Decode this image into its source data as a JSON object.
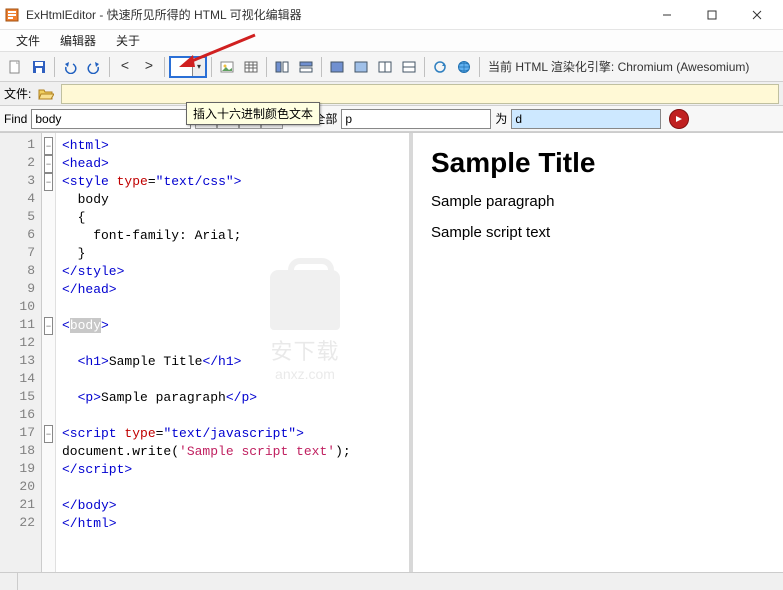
{
  "title": "ExHtmlEditor - 快速所见所得的 HTML 可视化编辑器",
  "menus": {
    "file": "文件",
    "editor": "编辑器",
    "about": "关于"
  },
  "toolbar": {
    "nav_back": "<",
    "nav_fwd": ">",
    "status_prefix": "当前 HTML 渲染化引擎:",
    "engine": "Chromium (Awesomium)"
  },
  "filebar": {
    "label": "文件:"
  },
  "findbar": {
    "find_label": "Find",
    "find_value": "body",
    "replace_all_label": "替换全部",
    "replace_value": "p",
    "to_label": "为",
    "to_value": "d"
  },
  "tooltip": "插入十六进制颜色文本",
  "code": {
    "lines": [
      {
        "n": 1,
        "fold": "-",
        "html": "<span class='t-tag'>&lt;html&gt;</span>"
      },
      {
        "n": 2,
        "fold": "-",
        "html": "<span class='t-tag'>&lt;head&gt;</span>"
      },
      {
        "n": 3,
        "fold": "-",
        "html": "<span class='t-tag'>&lt;style</span> <span class='t-attr'>type</span>=<span class='t-str'>\"text/css\"</span><span class='t-tag'>&gt;</span>"
      },
      {
        "n": 4,
        "fold": "",
        "html": "  body"
      },
      {
        "n": 5,
        "fold": "",
        "html": "  {"
      },
      {
        "n": 6,
        "fold": "",
        "html": "    font-family: Arial;"
      },
      {
        "n": 7,
        "fold": "",
        "html": "  }"
      },
      {
        "n": 8,
        "fold": "",
        "html": "<span class='t-tag'>&lt;/style&gt;</span>"
      },
      {
        "n": 9,
        "fold": "",
        "html": "<span class='t-tag'>&lt;/head&gt;</span>"
      },
      {
        "n": 10,
        "fold": "",
        "html": ""
      },
      {
        "n": 11,
        "fold": "-",
        "html": "<span class='t-tag'>&lt;</span><span class='t-sel'>body</span><span class='t-tag'>&gt;</span>"
      },
      {
        "n": 12,
        "fold": "",
        "html": ""
      },
      {
        "n": 13,
        "fold": "",
        "html": "  <span class='t-tag'>&lt;h1&gt;</span>Sample Title<span class='t-tag'>&lt;/h1&gt;</span>"
      },
      {
        "n": 14,
        "fold": "",
        "html": ""
      },
      {
        "n": 15,
        "fold": "",
        "html": "  <span class='t-tag'>&lt;p&gt;</span>Sample paragraph<span class='t-tag'>&lt;/p&gt;</span>"
      },
      {
        "n": 16,
        "fold": "",
        "html": ""
      },
      {
        "n": 17,
        "fold": "-",
        "html": "<span class='t-tag'>&lt;script</span> <span class='t-attr'>type</span>=<span class='t-str'>\"text/javascript\"</span><span class='t-tag'>&gt;</span>"
      },
      {
        "n": 18,
        "fold": "",
        "html": "document.write(<span class='t-jsstr'>'Sample script text'</span>);"
      },
      {
        "n": 19,
        "fold": "",
        "html": "<span class='t-tag'>&lt;/script&gt;</span>"
      },
      {
        "n": 20,
        "fold": "",
        "html": ""
      },
      {
        "n": 21,
        "fold": "",
        "html": "<span class='t-tag'>&lt;/body&gt;</span>"
      },
      {
        "n": 22,
        "fold": "",
        "html": "<span class='t-tag'>&lt;/html&gt;</span>"
      }
    ]
  },
  "preview": {
    "h1": "Sample Title",
    "p1": "Sample paragraph",
    "p2": "Sample script text"
  },
  "watermark": {
    "line1": "安下载",
    "line2": "anxz.com"
  }
}
